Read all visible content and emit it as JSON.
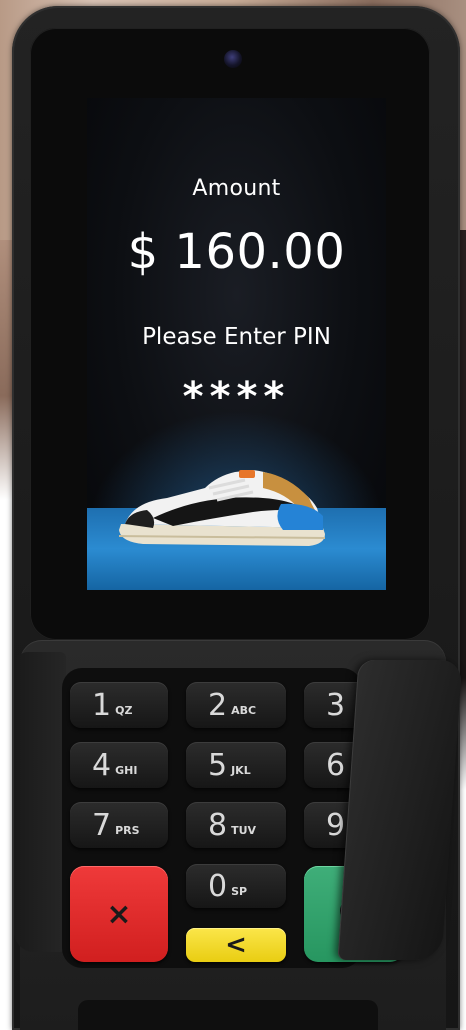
{
  "screen": {
    "amount_label": "Amount",
    "amount_value": "$ 160.00",
    "pin_prompt": "Please Enter PIN",
    "pin_mask": "****"
  },
  "keypad": {
    "keys": [
      {
        "num": "1",
        "sub": "QZ"
      },
      {
        "num": "2",
        "sub": "ABC"
      },
      {
        "num": "3",
        "sub": ""
      },
      {
        "num": "4",
        "sub": "GHI"
      },
      {
        "num": "5",
        "sub": "JKL"
      },
      {
        "num": "6",
        "sub": ""
      },
      {
        "num": "7",
        "sub": "PRS"
      },
      {
        "num": "8",
        "sub": "TUV"
      },
      {
        "num": "9",
        "sub": ""
      },
      {
        "num": "0",
        "sub": "SP"
      }
    ],
    "cancel_label": "×",
    "clear_label": "<"
  },
  "colors": {
    "cancel": "#e02a2a",
    "clear": "#f3d92a",
    "enter": "#34a36d",
    "stage": "#2b8bd1"
  },
  "icons": {
    "camera": "camera-lens-icon",
    "enter": "enter-circle-icon"
  }
}
